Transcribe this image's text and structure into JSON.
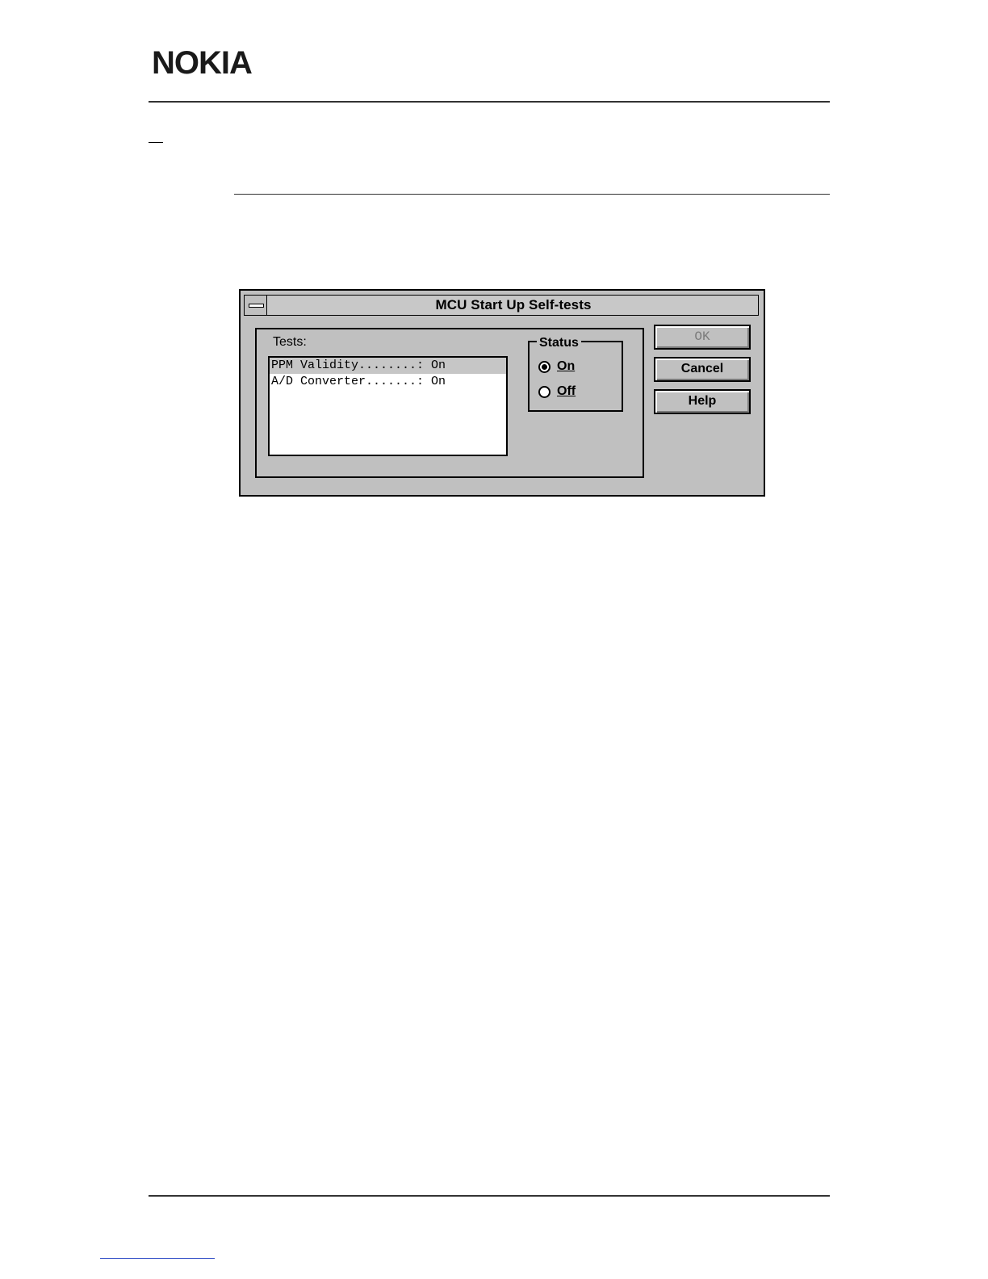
{
  "document": {
    "logo_text": "NOKIA"
  },
  "dialog": {
    "title": "MCU Start Up Self-tests",
    "tests": {
      "label": "Tests:",
      "items": [
        {
          "text": "PPM Validity........: On",
          "selected": true
        },
        {
          "text": "A/D Converter.......: On",
          "selected": false
        }
      ]
    },
    "status": {
      "label": "Status",
      "options": [
        {
          "label": "On",
          "checked": true
        },
        {
          "label": "Off",
          "checked": false
        }
      ]
    },
    "buttons": {
      "ok": "OK",
      "cancel": "Cancel",
      "help": "Help"
    }
  }
}
